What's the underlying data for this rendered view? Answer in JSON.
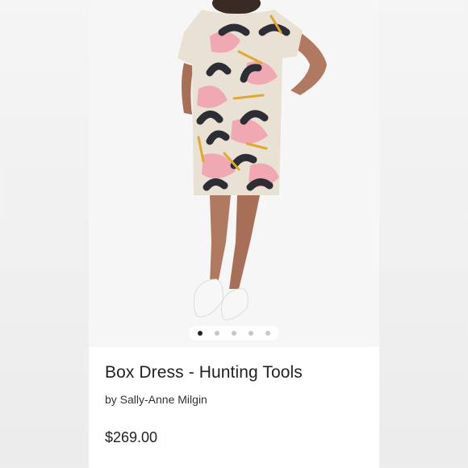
{
  "product": {
    "title": "Box Dress - Hunting Tools",
    "byline": "by Sally-Anne Milgin",
    "price": "$269.00"
  },
  "gallery": {
    "image_count": 5,
    "active_index": 0
  },
  "colors": {
    "card_bg": "#ffffff",
    "dot_active": "#222222",
    "dot_inactive": "#c7c7c7",
    "dress_base": "#e9e2d4",
    "dress_pink": "#f0a8b2",
    "dress_black": "#2d2d35",
    "dress_mustard": "#e0a830",
    "skin": "#b07a62",
    "sneaker": "#f7f7f7"
  }
}
